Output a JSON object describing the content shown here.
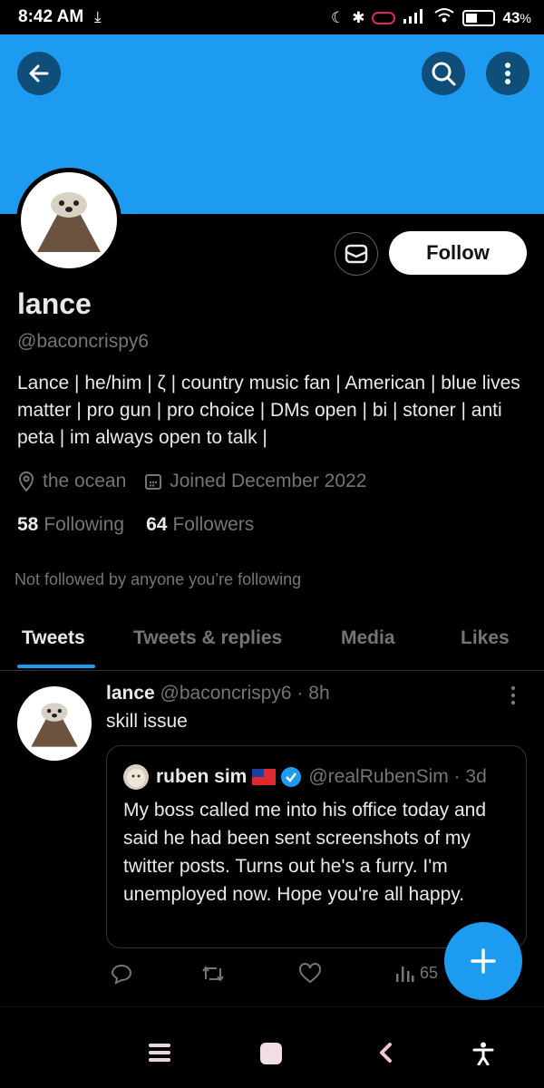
{
  "status_bar": {
    "time": "8:42 AM",
    "battery": "43",
    "battery_unit": "%",
    "battery_level": 0.43
  },
  "profile": {
    "name": "lance",
    "handle": "@baconcrispy6",
    "bio": "Lance | he/him | ζ | country music fan | American | blue lives matter | pro gun | pro choice | DMs open | bi | stoner | anti peta | im always open to talk |",
    "location": "the ocean",
    "joined": "Joined December 2022",
    "following_count": "58",
    "following_label": "Following",
    "followers_count": "64",
    "followers_label": "Followers",
    "not_followed_text": "Not followed by anyone you’re following",
    "follow_label": "Follow"
  },
  "tabs": [
    {
      "label": "Tweets"
    },
    {
      "label": "Tweets & replies"
    },
    {
      "label": "Media"
    },
    {
      "label": "Likes"
    }
  ],
  "tweet": {
    "name": "lance",
    "handle_time": "@baconcrispy6 · 8h",
    "text": "skill issue",
    "quote": {
      "name": "ruben sim",
      "handle_time": "@realRubenSim · 3d",
      "text": "My boss called me into his office today and said he had been sent screenshots of my twitter posts. Turns out he's a furry. I'm unemployed now. Hope you're all happy."
    },
    "views": "65"
  },
  "colors": {
    "accent": "#1d9bf0",
    "banner": "#1d9bf0",
    "background": "#000000",
    "muted": "#71767b"
  }
}
